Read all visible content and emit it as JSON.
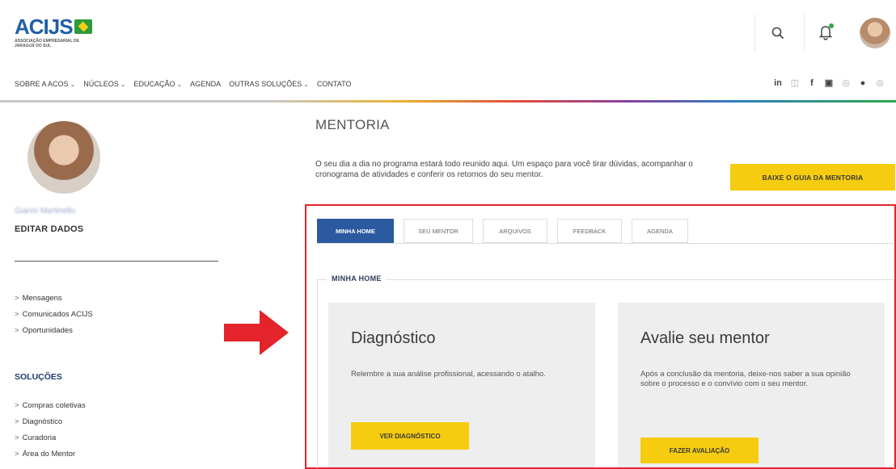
{
  "header": {
    "logo_text": "ACIJS",
    "logo_subtitle": "ASSOCIAÇÃO EMPRESARIAL DE JARAGUÁ DO SUL"
  },
  "nav": {
    "items": [
      {
        "label": "SOBRE A ACOS",
        "has_dropdown": true
      },
      {
        "label": "NÚCLEOS",
        "has_dropdown": true
      },
      {
        "label": "EDUCAÇÃO",
        "has_dropdown": true
      },
      {
        "label": "AGENDA",
        "has_dropdown": false
      },
      {
        "label": "OUTRAS SOLUÇÕES",
        "has_dropdown": true
      },
      {
        "label": "CONTATO",
        "has_dropdown": false
      }
    ],
    "chevron": "⌄",
    "social": [
      "in",
      "◫",
      "f",
      "▣",
      "◎",
      "●",
      "◎"
    ]
  },
  "sidebar": {
    "user_name": "Gianni Martinello",
    "edit_label": "EDITAR DADOS",
    "links": [
      "Mensagens",
      "Comunicados ACIJS",
      "Oportunidades"
    ],
    "solutions_heading": "SOLUÇÕES",
    "solutions_links": [
      "Compras coletivas",
      "Diagnóstico",
      "Curadoria",
      "Área do Mentor"
    ],
    "link_prefix": ">"
  },
  "main": {
    "title": "MENTORIA",
    "intro": "O seu dia a dia no programa estará todo reunido aqui. Um espaço para você tirar dúvidas, acompanhar o cronograma de atividades e conferir os retornos do seu mentor.",
    "guide_button": "BAIXE O GUIA DA MENTORIA",
    "tabs": [
      {
        "label": "MINHA HOME",
        "active": true
      },
      {
        "label": "SEU MENTOR",
        "active": false
      },
      {
        "label": "ARQUIVOS",
        "active": false
      },
      {
        "label": "FEEDBACK",
        "active": false
      },
      {
        "label": "AGENDA",
        "active": false
      }
    ],
    "section_label": "MINHA HOME",
    "cards": [
      {
        "title": "Diagnóstico",
        "text": "Relembre a sua análise profissional, acessando o atalho.",
        "button": "VER DIAGNÓSTICO"
      },
      {
        "title": "Avalie seu mentor",
        "text": "Após a conclusão da mentoria, deixe-nos saber a sua opinião sobre o processo e o convívio com o seu mentor.",
        "button": "FAZER AVALIAÇÃO"
      }
    ]
  },
  "colors": {
    "brand_blue": "#2c5aa0",
    "accent_yellow": "#f5cc0f",
    "highlight_red": "#e3242b",
    "notification_green": "#2ea84a"
  }
}
